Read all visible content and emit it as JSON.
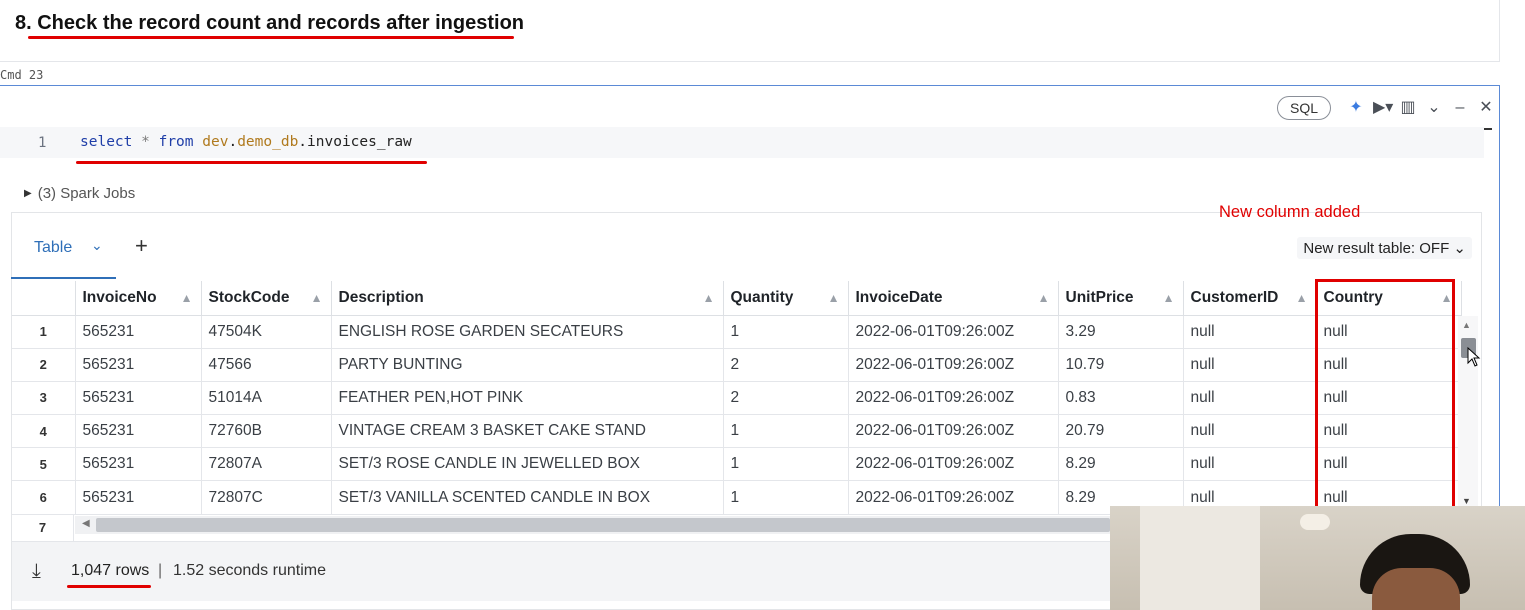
{
  "heading": {
    "text": "8. Check the record count and records after ingestion"
  },
  "cmd_label": "Cmd 23",
  "toolbar": {
    "language": "SQL",
    "icons": [
      "sparkle-icon",
      "run-icon",
      "chart-icon",
      "chevron-down-icon",
      "minimize-icon",
      "close-icon"
    ]
  },
  "editor": {
    "line_number": "1",
    "code": {
      "select": "select",
      "star": " * ",
      "from": "from",
      "space": " ",
      "schema1": "dev",
      "dot1": ".",
      "schema2": "demo_db",
      "dot2": ".",
      "table": "invoices_raw"
    }
  },
  "spark_jobs": "(3) Spark Jobs",
  "result_tabs": {
    "active": "Table",
    "toggle": "New result table: OFF"
  },
  "annotation": "New column added",
  "table": {
    "columns": [
      "InvoiceNo",
      "StockCode",
      "Description",
      "Quantity",
      "InvoiceDate",
      "UnitPrice",
      "CustomerID",
      "Country"
    ],
    "rows": [
      [
        "1",
        "565231",
        "47504K",
        "ENGLISH ROSE GARDEN SECATEURS",
        "1",
        "2022-06-01T09:26:00Z",
        "3.29",
        "null",
        "null"
      ],
      [
        "2",
        "565231",
        "47566",
        "PARTY BUNTING",
        "2",
        "2022-06-01T09:26:00Z",
        "10.79",
        "null",
        "null"
      ],
      [
        "3",
        "565231",
        "51014A",
        "FEATHER PEN,HOT PINK",
        "2",
        "2022-06-01T09:26:00Z",
        "0.83",
        "null",
        "null"
      ],
      [
        "4",
        "565231",
        "72760B",
        "VINTAGE CREAM 3 BASKET CAKE STAND",
        "1",
        "2022-06-01T09:26:00Z",
        "20.79",
        "null",
        "null"
      ],
      [
        "5",
        "565231",
        "72807A",
        "SET/3 ROSE CANDLE IN JEWELLED BOX",
        "1",
        "2022-06-01T09:26:00Z",
        "8.29",
        "null",
        "null"
      ],
      [
        "6",
        "565231",
        "72807C",
        "SET/3 VANILLA SCENTED CANDLE IN BOX",
        "1",
        "2022-06-01T09:26:00Z",
        "8.29",
        "null",
        "null"
      ]
    ],
    "partial_row_number": "7"
  },
  "footer": {
    "rows": "1,047 rows",
    "separator": "|",
    "runtime": "1.52 seconds runtime"
  }
}
